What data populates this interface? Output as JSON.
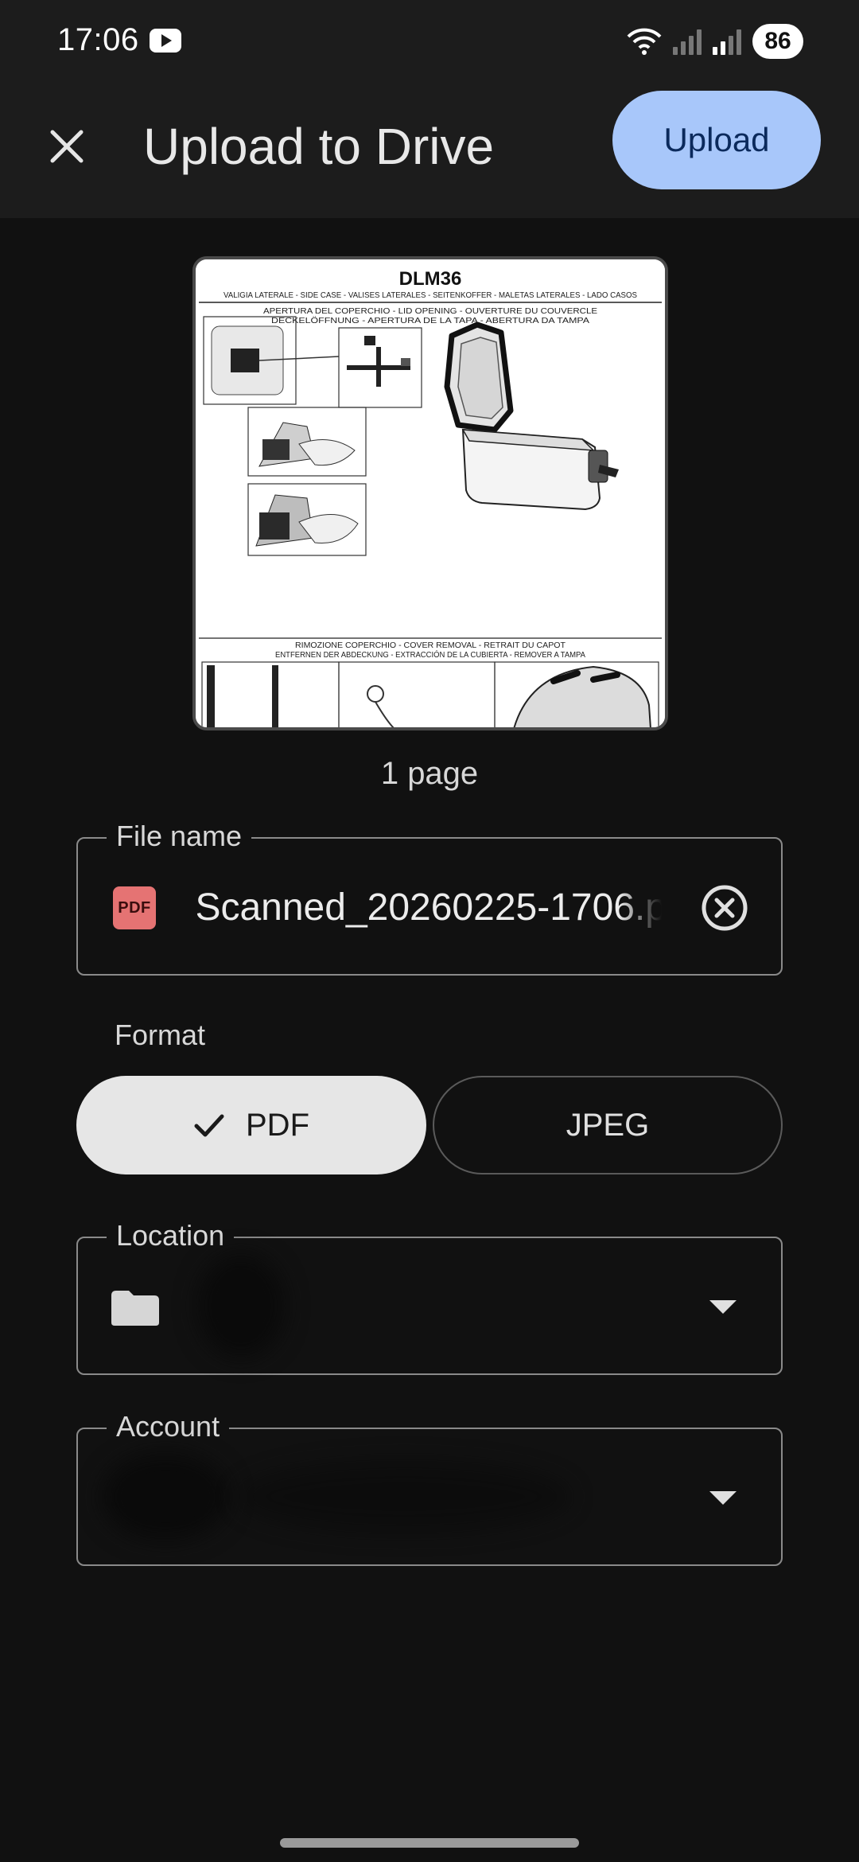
{
  "status_bar": {
    "time": "17:06",
    "battery": "86",
    "icons": [
      "youtube-icon",
      "wifi-icon",
      "signal-icon",
      "signal-roaming-icon",
      "battery-icon"
    ]
  },
  "app_bar": {
    "title": "Upload to Drive",
    "upload_label": "Upload",
    "close_icon": "close-icon"
  },
  "preview": {
    "doc_title": "DLM36",
    "doc_subtitle": "VALIGIA LATERALE - SIDE CASE - VALISES LATERALES - SEITENKOFFER - MALETAS LATERALES - LADO CASOS",
    "section1_line1": "APERTURA DEL COPERCHIO - LID OPENING - OUVERTURE DU COUVERCLE",
    "section1_line2": "DECKELÖFFNUNG - APERTURA DE LA TAPA - ABERTURA DA TAMPA",
    "section2_line1": "RIMOZIONE COPERCHIO - COVER REMOVAL - RETRAIT DU CAPOT",
    "section2_line2": "ENTFERNEN DER ABDECKUNG - EXTRACCIÓN DE LA CUBIERTA - REMOVER A TAMPA",
    "page_count": "1 page"
  },
  "file_name": {
    "label": "File name",
    "value": "Scanned_20260225-1706.p",
    "icon_text": "PDF"
  },
  "format": {
    "label": "Format",
    "options": [
      {
        "label": "PDF",
        "selected": true
      },
      {
        "label": "JPEG",
        "selected": false
      }
    ]
  },
  "location": {
    "label": "Location",
    "value": ""
  },
  "account": {
    "label": "Account",
    "value": ""
  },
  "colors": {
    "accent": "#a8c7fa",
    "background": "#111111",
    "appbar": "#1c1c1c"
  }
}
